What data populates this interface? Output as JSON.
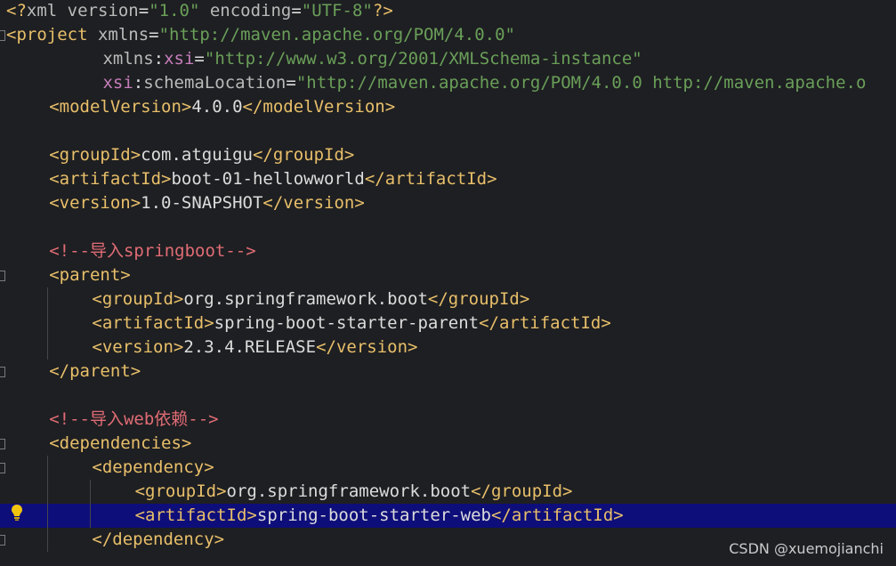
{
  "colors": {
    "background": "#1e1f22",
    "current_line": "#0e0e7a",
    "tag": "#e8bf6a",
    "text": "#dcdcdc",
    "value": "#6a9f59",
    "comment": "#e06c75",
    "namespace": "#c77dbb",
    "attribute": "#bababa",
    "guide": "#45464a"
  },
  "lines": [
    {
      "indent": 0,
      "tokens": [
        {
          "t": "<?",
          "c": "tag"
        },
        {
          "t": "xml version",
          "c": "attribute"
        },
        {
          "t": "=",
          "c": "text"
        },
        {
          "t": "\"1.0\"",
          "c": "value"
        },
        {
          "t": " encoding",
          "c": "attribute"
        },
        {
          "t": "=",
          "c": "text"
        },
        {
          "t": "\"UTF-8\"",
          "c": "value"
        },
        {
          "t": "?>",
          "c": "tag"
        }
      ]
    },
    {
      "indent": 0,
      "tokens": [
        {
          "t": "<project",
          "c": "tag"
        },
        {
          "t": " xmlns",
          "c": "attribute"
        },
        {
          "t": "=",
          "c": "text"
        },
        {
          "t": "\"http://maven.apache.org/POM/4.0.0\"",
          "c": "value"
        }
      ]
    },
    {
      "indent": 9,
      "tokens": [
        {
          "t": "xmlns",
          "c": "attribute"
        },
        {
          "t": ":",
          "c": "text"
        },
        {
          "t": "xsi",
          "c": "namespace"
        },
        {
          "t": "=",
          "c": "text"
        },
        {
          "t": "\"http://www.w3.org/2001/XMLSchema-instance\"",
          "c": "value"
        }
      ]
    },
    {
      "indent": 9,
      "tokens": [
        {
          "t": "xsi",
          "c": "namespace"
        },
        {
          "t": ":",
          "c": "text"
        },
        {
          "t": "schemaLocation",
          "c": "attribute"
        },
        {
          "t": "=",
          "c": "text"
        },
        {
          "t": "\"http://maven.apache.org/POM/4.0.0 http://maven.apache.o",
          "c": "value"
        }
      ]
    },
    {
      "indent": 4,
      "tokens": [
        {
          "t": "<modelVersion>",
          "c": "tag"
        },
        {
          "t": "4.0.0",
          "c": "text"
        },
        {
          "t": "</modelVersion>",
          "c": "tag"
        }
      ]
    },
    {
      "indent": 0,
      "tokens": []
    },
    {
      "indent": 4,
      "tokens": [
        {
          "t": "<groupId>",
          "c": "tag"
        },
        {
          "t": "com.atguigu",
          "c": "text"
        },
        {
          "t": "</groupId>",
          "c": "tag"
        }
      ]
    },
    {
      "indent": 4,
      "tokens": [
        {
          "t": "<artifactId>",
          "c": "tag"
        },
        {
          "t": "boot-01-hellowworld",
          "c": "text"
        },
        {
          "t": "</artifactId>",
          "c": "tag"
        }
      ]
    },
    {
      "indent": 4,
      "tokens": [
        {
          "t": "<version>",
          "c": "tag"
        },
        {
          "t": "1.0-SNAPSHOT",
          "c": "text"
        },
        {
          "t": "</version>",
          "c": "tag"
        }
      ]
    },
    {
      "indent": 0,
      "tokens": []
    },
    {
      "indent": 4,
      "tokens": [
        {
          "t": "<!--导入springboot-->",
          "c": "comment"
        }
      ]
    },
    {
      "indent": 4,
      "tokens": [
        {
          "t": "<parent>",
          "c": "tag"
        }
      ]
    },
    {
      "indent": 8,
      "tokens": [
        {
          "t": "<groupId>",
          "c": "tag"
        },
        {
          "t": "org.springframework.boot",
          "c": "text"
        },
        {
          "t": "</groupId>",
          "c": "tag"
        }
      ]
    },
    {
      "indent": 8,
      "tokens": [
        {
          "t": "<artifactId>",
          "c": "tag"
        },
        {
          "t": "spring-boot-starter-parent",
          "c": "text"
        },
        {
          "t": "</artifactId>",
          "c": "tag"
        }
      ]
    },
    {
      "indent": 8,
      "tokens": [
        {
          "t": "<version>",
          "c": "tag"
        },
        {
          "t": "2.3.4.RELEASE",
          "c": "text"
        },
        {
          "t": "</version>",
          "c": "tag"
        }
      ]
    },
    {
      "indent": 4,
      "tokens": [
        {
          "t": "</parent>",
          "c": "tag"
        }
      ]
    },
    {
      "indent": 0,
      "tokens": []
    },
    {
      "indent": 4,
      "tokens": [
        {
          "t": "<!--导入web依赖-->",
          "c": "comment"
        }
      ]
    },
    {
      "indent": 4,
      "tokens": [
        {
          "t": "<dependencies>",
          "c": "tag"
        }
      ]
    },
    {
      "indent": 8,
      "tokens": [
        {
          "t": "<dependency>",
          "c": "tag"
        }
      ]
    },
    {
      "indent": 12,
      "tokens": [
        {
          "t": "<groupId>",
          "c": "tag"
        },
        {
          "t": "org.springframework.boot",
          "c": "text"
        },
        {
          "t": "</groupId>",
          "c": "tag"
        }
      ]
    },
    {
      "indent": 12,
      "current": true,
      "tokens": [
        {
          "t": "<artifactId>",
          "c": "tag"
        },
        {
          "t": "spring-boot-starter-web",
          "c": "text"
        },
        {
          "t": "</artifactId>",
          "c": "tag"
        }
      ]
    },
    {
      "indent": 8,
      "tokens": [
        {
          "t": "</dependency>",
          "c": "tag"
        }
      ]
    }
  ],
  "folds": [
    1,
    11,
    15,
    18,
    19,
    22
  ],
  "guides": [
    {
      "col": 4,
      "from": 12,
      "to": 14
    },
    {
      "col": 4,
      "from": 19,
      "to": 22
    },
    {
      "col": 8,
      "from": 20,
      "to": 21
    }
  ],
  "icons": {
    "bulb": "lightbulb-icon",
    "fold": "fold-marker-icon"
  },
  "watermark": "CSDN @xuemojianchi"
}
